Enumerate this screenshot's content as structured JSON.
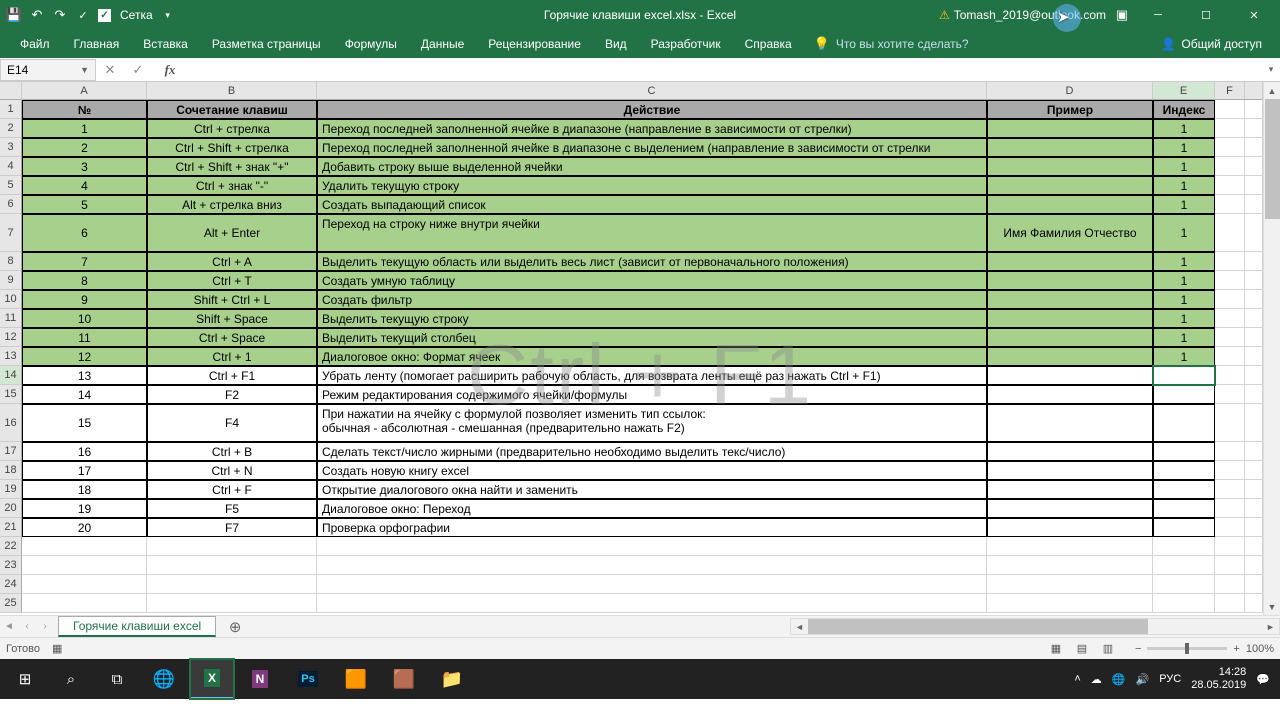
{
  "title": "Горячие клавиши excel.xlsx - Excel",
  "qat": {
    "grid": "Сетка"
  },
  "user": "Tomash_2019@outlook.com",
  "tabs": [
    "Файл",
    "Главная",
    "Вставка",
    "Разметка страницы",
    "Формулы",
    "Данные",
    "Рецензирование",
    "Вид",
    "Разработчик",
    "Справка"
  ],
  "tellme": "Что вы хотите сделать?",
  "share": "Общий доступ",
  "namebox": "E14",
  "watermark": "Ctrl + F1",
  "cols": [
    "A",
    "B",
    "C",
    "D",
    "E",
    "F"
  ],
  "headers": {
    "num": "№",
    "combo": "Сочетание клавиш",
    "action": "Действие",
    "example": "Пример",
    "index": "Индекс"
  },
  "rows": [
    {
      "r": 2,
      "n": "1",
      "k": "Ctrl + стрелка",
      "a": "Переход последней заполненной ячейке в диапазоне (направление в зависимости от стрелки)",
      "e": "",
      "i": "1",
      "g": true,
      "h": 19
    },
    {
      "r": 3,
      "n": "2",
      "k": "Ctrl + Shift + стрелка",
      "a": "Переход последней заполненной ячейке в диапазоне с выделением (направление в зависимости от стрелки",
      "e": "",
      "i": "1",
      "g": true,
      "h": 19
    },
    {
      "r": 4,
      "n": "3",
      "k": "Ctrl + Shift + знак \"+\"",
      "a": "Добавить строку выше выделенной ячейки",
      "e": "",
      "i": "1",
      "g": true,
      "h": 19
    },
    {
      "r": 5,
      "n": "4",
      "k": "Ctrl + знак \"-\"",
      "a": "Удалить текущую строку",
      "e": "",
      "i": "1",
      "g": true,
      "h": 19
    },
    {
      "r": 6,
      "n": "5",
      "k": "Alt + стрелка вниз",
      "a": "Создать выпадающий список",
      "e": "",
      "i": "1",
      "g": true,
      "h": 19
    },
    {
      "r": 7,
      "n": "6",
      "k": "Alt + Enter",
      "a": "Переход на строку ниже внутри ячейки",
      "e": "Имя Фамилия Отчество",
      "i": "1",
      "g": true,
      "h": 38
    },
    {
      "r": 8,
      "n": "7",
      "k": "Ctrl + A",
      "a": "Выделить текущую область или выделить весь лист (зависит от первоначального положения)",
      "e": "",
      "i": "1",
      "g": true,
      "h": 19
    },
    {
      "r": 9,
      "n": "8",
      "k": "Ctrl + T",
      "a": "Создать умную таблицу",
      "e": "",
      "i": "1",
      "g": true,
      "h": 19
    },
    {
      "r": 10,
      "n": "9",
      "k": "Shift + Ctrl + L",
      "a": "Создать фильтр",
      "e": "",
      "i": "1",
      "g": true,
      "h": 19
    },
    {
      "r": 11,
      "n": "10",
      "k": "Shift + Space",
      "a": "Выделить текущую строку",
      "e": "",
      "i": "1",
      "g": true,
      "h": 19
    },
    {
      "r": 12,
      "n": "11",
      "k": "Ctrl + Space",
      "a": "Выделить текущий столбец",
      "e": "",
      "i": "1",
      "g": true,
      "h": 19
    },
    {
      "r": 13,
      "n": "12",
      "k": "Ctrl + 1",
      "a": "Диалоговое окно: Формат ячеек",
      "e": "",
      "i": "1",
      "g": true,
      "h": 19
    },
    {
      "r": 14,
      "n": "13",
      "k": "Ctrl + F1",
      "a": "Убрать ленту (помогает расширить рабочую область, для возврата ленты ещё раз нажать Ctrl + F1)",
      "e": "",
      "i": "",
      "g": false,
      "h": 19,
      "sel": true
    },
    {
      "r": 15,
      "n": "14",
      "k": "F2",
      "a": "Режим редактирования содержимого ячейки/формулы",
      "e": "",
      "i": "",
      "g": false,
      "h": 19
    },
    {
      "r": 16,
      "n": "15",
      "k": "F4",
      "a": "При нажатии на ячейку с формулой позволяет изменить тип ссылок:\nобычная - абсолютная - смешанная (предварительно нажать F2)",
      "e": "",
      "i": "",
      "g": false,
      "h": 38
    },
    {
      "r": 17,
      "n": "16",
      "k": "Ctrl + B",
      "a": "Сделать текст/число жирными (предварительно необходимо выделить текс/число)",
      "e": "",
      "i": "",
      "g": false,
      "h": 19
    },
    {
      "r": 18,
      "n": "17",
      "k": "Ctrl + N",
      "a": "Создать новую книгу excel",
      "e": "",
      "i": "",
      "g": false,
      "h": 19
    },
    {
      "r": 19,
      "n": "18",
      "k": "Ctrl + F",
      "a": "Открытие диалогового окна найти и заменить",
      "e": "",
      "i": "",
      "g": false,
      "h": 19
    },
    {
      "r": 20,
      "n": "19",
      "k": "F5",
      "a": "Диалоговое окно: Переход",
      "e": "",
      "i": "",
      "g": false,
      "h": 19
    },
    {
      "r": 21,
      "n": "20",
      "k": "F7",
      "a": "Проверка орфографии",
      "e": "",
      "i": "",
      "g": false,
      "h": 19
    }
  ],
  "emptyrows": [
    22,
    23,
    24,
    25
  ],
  "sheettab": "Горячие клавиши excel",
  "status": "Готово",
  "zoom": "100%",
  "lang": "РУС",
  "time": "14:28",
  "date": "28.05.2019"
}
